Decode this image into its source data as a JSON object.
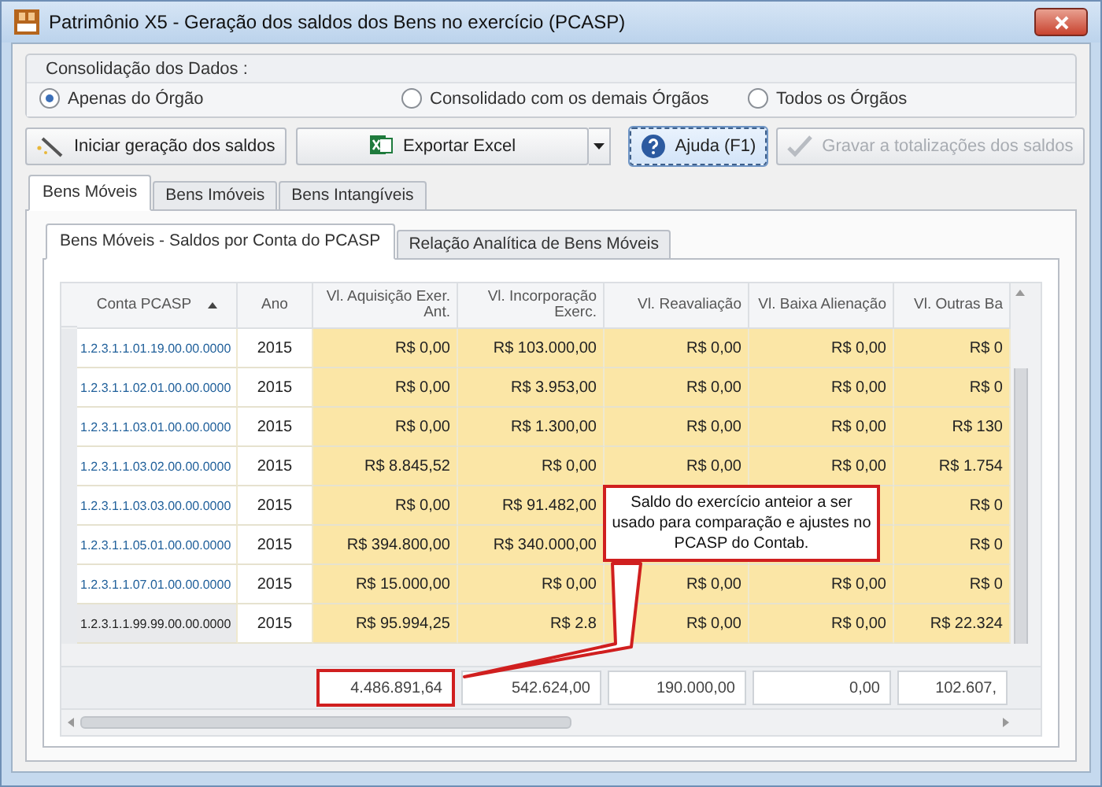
{
  "window": {
    "title": "Patrimônio X5 - Geração dos saldos dos Bens no exercício (PCASP)"
  },
  "consolidation": {
    "label": "Consolidação dos Dados :",
    "options": [
      {
        "label": "Apenas do Órgão",
        "selected": true
      },
      {
        "label": "Consolidado com os demais Órgãos",
        "selected": false
      },
      {
        "label": "Todos os Órgãos",
        "selected": false
      }
    ]
  },
  "toolbar": [
    {
      "kind": "button",
      "label": "Iniciar geração dos saldos",
      "disabled": false,
      "focused": false
    },
    {
      "kind": "split",
      "label": "Exportar Excel",
      "disabled": false,
      "focused": false
    },
    {
      "kind": "button",
      "label": "Ajuda (F1)",
      "disabled": false,
      "focused": true
    },
    {
      "kind": "button",
      "label": "Gravar a totalizações dos saldos",
      "disabled": true,
      "focused": false
    }
  ],
  "tabs": [
    {
      "label": "Bens Móveis",
      "selected": true
    },
    {
      "label": "Bens Imóveis",
      "selected": false
    },
    {
      "label": "Bens Intangíveis",
      "selected": false
    }
  ],
  "subtabs": [
    {
      "label": "Bens Móveis - Saldos por Conta do PCASP",
      "selected": true
    },
    {
      "label": "Relação Analítica de Bens Móveis",
      "selected": false
    }
  ],
  "table": {
    "columns": [
      "Conta PCASP",
      "Ano",
      "Vl. Aquisição Exer. Ant.",
      "Vl. Incorporação Exerc.",
      "Vl. Reavaliação",
      "Vl. Baixa Alienação",
      "Vl. Outras Ba"
    ],
    "rows": [
      {
        "selected": false,
        "cells": [
          "1.2.3.1.1.01.19.00.00.0000",
          "2015",
          "R$ 0,00",
          "R$ 103.000,00",
          "R$ 0,00",
          "R$ 0,00",
          "R$ 0"
        ]
      },
      {
        "selected": false,
        "cells": [
          "1.2.3.1.1.02.01.00.00.0000",
          "2015",
          "R$ 0,00",
          "R$ 3.953,00",
          "R$ 0,00",
          "R$ 0,00",
          "R$ 0"
        ]
      },
      {
        "selected": false,
        "cells": [
          "1.2.3.1.1.03.01.00.00.0000",
          "2015",
          "R$ 0,00",
          "R$ 1.300,00",
          "R$ 0,00",
          "R$ 0,00",
          "R$ 130"
        ]
      },
      {
        "selected": false,
        "cells": [
          "1.2.3.1.1.03.02.00.00.0000",
          "2015",
          "R$ 8.845,52",
          "R$ 0,00",
          "R$ 0,00",
          "R$ 0,00",
          "R$ 1.754"
        ]
      },
      {
        "selected": false,
        "cells": [
          "1.2.3.1.1.03.03.00.00.0000",
          "2015",
          "R$ 0,00",
          "R$ 91.482,00",
          null,
          null,
          "R$ 0"
        ]
      },
      {
        "selected": false,
        "cells": [
          "1.2.3.1.1.05.01.00.00.0000",
          "2015",
          "R$ 394.800,00",
          "R$ 340.000,00",
          null,
          null,
          "R$ 0"
        ]
      },
      {
        "selected": false,
        "cells": [
          "1.2.3.1.1.07.01.00.00.0000",
          "2015",
          "R$ 15.000,00",
          "R$ 0,00",
          "R$ 0,00",
          "R$ 0,00",
          "R$ 0"
        ]
      },
      {
        "selected": true,
        "cells": [
          "1.2.3.1.1.99.99.00.00.0000",
          "2015",
          "R$ 95.994,25",
          "R$ 2.8",
          "R$ 0,00",
          "R$ 0,00",
          "R$ 22.324"
        ]
      }
    ],
    "totals": [
      {
        "value": "4.486.891,64",
        "highlighted": true
      },
      {
        "value": "542.624,00",
        "highlighted": false
      },
      {
        "value": "190.000,00",
        "highlighted": false
      },
      {
        "value": "0,00",
        "highlighted": false
      },
      {
        "value": "102.607,",
        "highlighted": false
      }
    ]
  },
  "callout": {
    "text": "Saldo do exercício anteior a ser usado para comparação e ajustes no PCASP do Contab."
  }
}
